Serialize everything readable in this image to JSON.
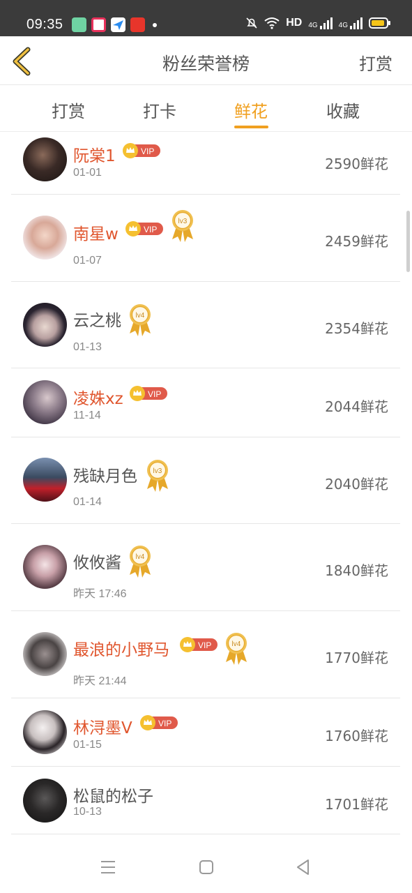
{
  "status": {
    "time": "09:35",
    "network_label": "HD",
    "gen1": "4G",
    "gen2": "4G",
    "battery_color": "#f5c518"
  },
  "header": {
    "title": "粉丝荣誉榜",
    "action": "打赏",
    "back_icon": "chevron-left-icon"
  },
  "tabs": [
    {
      "label": "打赏"
    },
    {
      "label": "打卡"
    },
    {
      "label": "鲜花"
    },
    {
      "label": "收藏"
    }
  ],
  "active_tab": 2,
  "accent_color": "#f0a020",
  "vip_name_color": "#e0562e",
  "fans": [
    {
      "name": "阮棠1",
      "vip": true,
      "level": null,
      "date": "01-01",
      "amount": "2590鲜花"
    },
    {
      "name": "南星w",
      "vip": true,
      "level": "lv3",
      "date": "01-07",
      "amount": "2459鲜花"
    },
    {
      "name": "云之桃",
      "vip": false,
      "level": "lv4",
      "date": "01-13",
      "amount": "2354鲜花"
    },
    {
      "name": "凌姝xz",
      "vip": true,
      "level": null,
      "date": "11-14",
      "amount": "2044鲜花"
    },
    {
      "name": "残缺月色",
      "vip": false,
      "level": "lv3",
      "date": "01-14",
      "amount": "2040鲜花"
    },
    {
      "name": "攸攸酱",
      "vip": false,
      "level": "lv4",
      "date": "昨天 17:46",
      "amount": "1840鲜花"
    },
    {
      "name": "最浪的小野马",
      "vip": true,
      "level": "lv4",
      "date": "昨天 21:44",
      "amount": "1770鲜花"
    },
    {
      "name": "林浔墨V",
      "vip": true,
      "level": null,
      "date": "01-15",
      "amount": "1760鲜花"
    },
    {
      "name": "松鼠的松子",
      "vip": false,
      "level": null,
      "date": "10-13",
      "amount": "1701鲜花"
    }
  ],
  "vip_label": "VIP"
}
